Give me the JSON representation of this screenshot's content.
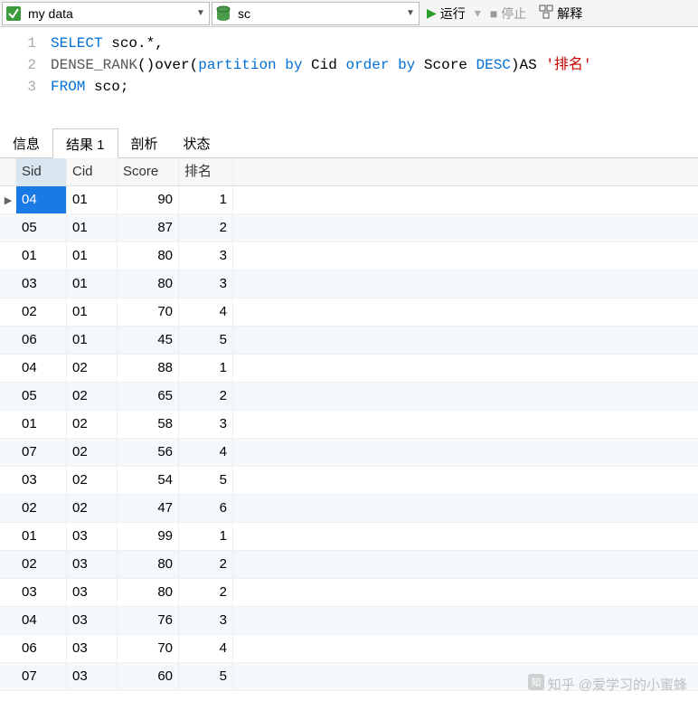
{
  "toolbar": {
    "connection": "my data",
    "database": "sc",
    "run": "运行",
    "stop": "停止",
    "explain": "解释"
  },
  "editor": {
    "lines": [
      "1",
      "2",
      "3"
    ],
    "tokens": {
      "select": "SELECT",
      "sco_star": " sco.*,",
      "dense_rank": "DENSE_RANK",
      "over_open": "()over(",
      "partition_by": "partition by",
      "cid": " Cid ",
      "order_by": "order by",
      "score": " Score ",
      "desc": "DESC",
      "close_as": ")AS ",
      "alias": "'排名'",
      "from": "FROM",
      "sco_end": " sco;"
    }
  },
  "tabs": {
    "info": "信息",
    "result1": "结果 1",
    "profile": "剖析",
    "status": "状态"
  },
  "grid": {
    "headers": [
      "Sid",
      "Cid",
      "Score",
      "排名"
    ],
    "rows": [
      {
        "sid": "04",
        "cid": "01",
        "score": "90",
        "rank": "1",
        "sel": true
      },
      {
        "sid": "05",
        "cid": "01",
        "score": "87",
        "rank": "2"
      },
      {
        "sid": "01",
        "cid": "01",
        "score": "80",
        "rank": "3"
      },
      {
        "sid": "03",
        "cid": "01",
        "score": "80",
        "rank": "3"
      },
      {
        "sid": "02",
        "cid": "01",
        "score": "70",
        "rank": "4"
      },
      {
        "sid": "06",
        "cid": "01",
        "score": "45",
        "rank": "5"
      },
      {
        "sid": "04",
        "cid": "02",
        "score": "88",
        "rank": "1"
      },
      {
        "sid": "05",
        "cid": "02",
        "score": "65",
        "rank": "2"
      },
      {
        "sid": "01",
        "cid": "02",
        "score": "58",
        "rank": "3"
      },
      {
        "sid": "07",
        "cid": "02",
        "score": "56",
        "rank": "4"
      },
      {
        "sid": "03",
        "cid": "02",
        "score": "54",
        "rank": "5"
      },
      {
        "sid": "02",
        "cid": "02",
        "score": "47",
        "rank": "6"
      },
      {
        "sid": "01",
        "cid": "03",
        "score": "99",
        "rank": "1"
      },
      {
        "sid": "02",
        "cid": "03",
        "score": "80",
        "rank": "2"
      },
      {
        "sid": "03",
        "cid": "03",
        "score": "80",
        "rank": "2"
      },
      {
        "sid": "04",
        "cid": "03",
        "score": "76",
        "rank": "3"
      },
      {
        "sid": "06",
        "cid": "03",
        "score": "70",
        "rank": "4"
      },
      {
        "sid": "07",
        "cid": "03",
        "score": "60",
        "rank": "5"
      }
    ]
  },
  "watermark": {
    "site": "知乎",
    "author": "@爱学习的小蜜蜂"
  }
}
